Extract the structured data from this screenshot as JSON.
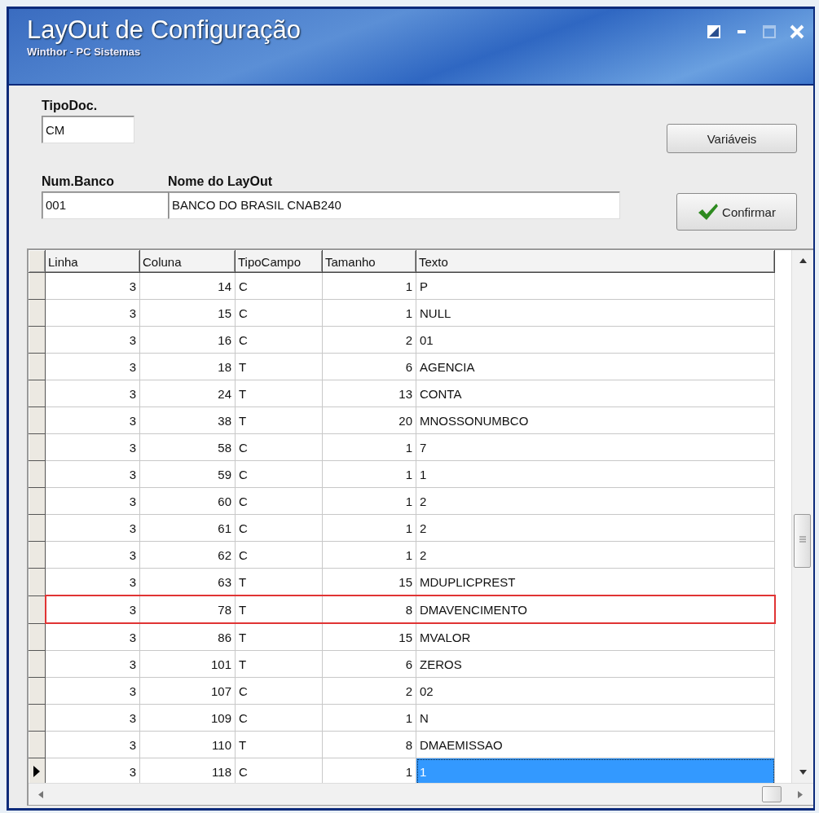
{
  "window": {
    "title": "LayOut de Configuração",
    "subtitle": "Winthor - PC Sistemas",
    "maximize_disabled": true
  },
  "form": {
    "fields": [
      {
        "label": "TipoDoc.",
        "value": "CM"
      },
      {
        "label": "Num.Banco",
        "value": "001"
      },
      {
        "label": "Nome do LayOut",
        "value": "BANCO DO BRASIL CNAB240"
      }
    ]
  },
  "buttons": [
    {
      "label": "Variáveis",
      "kind": "plain"
    },
    {
      "label": "Confirmar",
      "kind": "confirm"
    }
  ],
  "grid": {
    "columns": [
      "Linha",
      "Coluna",
      "TipoCampo",
      "Tamanho",
      "Texto"
    ],
    "rows": [
      {
        "cells": [
          "3",
          "14",
          "C",
          "1",
          "P"
        ],
        "highlighted": false,
        "selected": false
      },
      {
        "cells": [
          "3",
          "15",
          "C",
          "1",
          "NULL"
        ],
        "highlighted": false,
        "selected": false
      },
      {
        "cells": [
          "3",
          "16",
          "C",
          "2",
          "01"
        ],
        "highlighted": false,
        "selected": false
      },
      {
        "cells": [
          "3",
          "18",
          "T",
          "6",
          "AGENCIA"
        ],
        "highlighted": false,
        "selected": false
      },
      {
        "cells": [
          "3",
          "24",
          "T",
          "13",
          "CONTA"
        ],
        "highlighted": false,
        "selected": false
      },
      {
        "cells": [
          "3",
          "38",
          "T",
          "20",
          "MNOSSONUMBCO"
        ],
        "highlighted": false,
        "selected": false
      },
      {
        "cells": [
          "3",
          "58",
          "C",
          "1",
          "7"
        ],
        "highlighted": false,
        "selected": false
      },
      {
        "cells": [
          "3",
          "59",
          "C",
          "1",
          "1"
        ],
        "highlighted": false,
        "selected": false
      },
      {
        "cells": [
          "3",
          "60",
          "C",
          "1",
          "2"
        ],
        "highlighted": false,
        "selected": false
      },
      {
        "cells": [
          "3",
          "61",
          "C",
          "1",
          "2"
        ],
        "highlighted": false,
        "selected": false
      },
      {
        "cells": [
          "3",
          "62",
          "C",
          "1",
          "2"
        ],
        "highlighted": false,
        "selected": false
      },
      {
        "cells": [
          "3",
          "63",
          "T",
          "15",
          "MDUPLICPREST"
        ],
        "highlighted": false,
        "selected": false
      },
      {
        "cells": [
          "3",
          "78",
          "T",
          "8",
          "DMAVENCIMENTO"
        ],
        "highlighted": true,
        "selected": false
      },
      {
        "cells": [
          "3",
          "86",
          "T",
          "15",
          "MVALOR"
        ],
        "highlighted": false,
        "selected": false
      },
      {
        "cells": [
          "3",
          "101",
          "T",
          "6",
          "ZEROS"
        ],
        "highlighted": false,
        "selected": false
      },
      {
        "cells": [
          "3",
          "107",
          "C",
          "2",
          "02"
        ],
        "highlighted": false,
        "selected": false
      },
      {
        "cells": [
          "3",
          "109",
          "C",
          "1",
          "N"
        ],
        "highlighted": false,
        "selected": false
      },
      {
        "cells": [
          "3",
          "110",
          "T",
          "8",
          "DMAEMISSAO"
        ],
        "highlighted": false,
        "selected": false
      },
      {
        "cells": [
          "3",
          "118",
          "C",
          "1",
          "1"
        ],
        "highlighted": false,
        "selected": true
      }
    ]
  }
}
